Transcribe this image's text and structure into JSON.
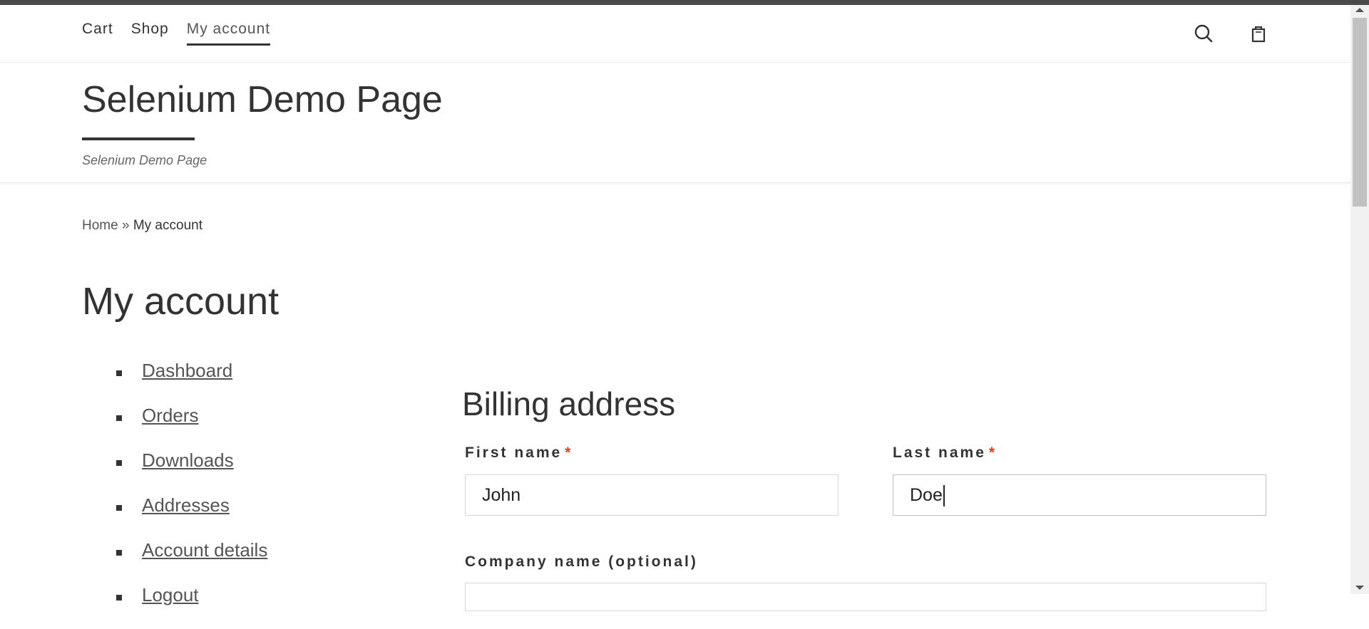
{
  "nav": {
    "links": [
      {
        "label": "Cart"
      },
      {
        "label": "Shop"
      },
      {
        "label": "My account"
      }
    ],
    "icons": [
      "search-icon",
      "shopping-bag-icon"
    ]
  },
  "header": {
    "site_title": "Selenium Demo Page",
    "tagline": "Selenium Demo Page"
  },
  "breadcrumb": {
    "home": "Home",
    "separator": "»",
    "current": "My account"
  },
  "page_title": "My account",
  "account_nav": [
    {
      "label": "Dashboard"
    },
    {
      "label": "Orders"
    },
    {
      "label": "Downloads"
    },
    {
      "label": "Addresses"
    },
    {
      "label": "Account details"
    },
    {
      "label": "Logout"
    }
  ],
  "billing": {
    "title": "Billing address",
    "required_mark": "*",
    "first_name": {
      "label": "First name",
      "value": "John"
    },
    "last_name": {
      "label": "Last name",
      "value": "Doe"
    },
    "company": {
      "label": "Company name (optional)",
      "value": ""
    }
  },
  "colors": {
    "accent": "#333333",
    "required": "#e2401c",
    "top_strip": "#4a4a4a"
  }
}
